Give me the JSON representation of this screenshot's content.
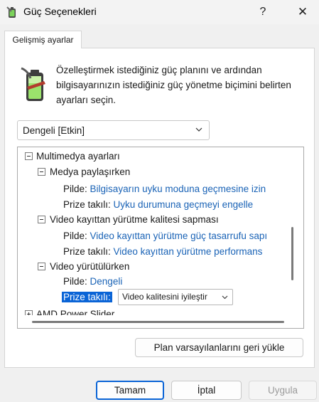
{
  "window": {
    "title": "Güç Seçenekleri",
    "help_label": "?",
    "close_label": "✕"
  },
  "tab": {
    "label": "Gelişmiş ayarlar"
  },
  "intro_text": "Özelleştirmek istediğiniz güç planını ve ardından bilgisayarınızın istediğiniz güç yönetme biçimini belirten ayarları seçin.",
  "plan_select": {
    "value": "Dengeli [Etkin]"
  },
  "tree": {
    "multimedia": "Multimedya ayarları",
    "media_sharing": "Medya paylaşırken",
    "ms_battery_label": "Pilde:",
    "ms_battery_value": "Bilgisayarın uyku moduna geçmesine izin",
    "ms_plugged_label": "Prize takılı:",
    "ms_plugged_value": "Uyku durumuna geçmeyi engelle",
    "video_quality": "Video kayıttan yürütme kalitesi sapması",
    "vq_battery_label": "Pilde:",
    "vq_battery_value": "Video kayıttan yürütme güç tasarrufu sapı",
    "vq_plugged_label": "Prize takılı:",
    "vq_plugged_value": "Video kayıttan yürütme performans",
    "video_playing": "Video yürütülürken",
    "vp_battery_label": "Pilde:",
    "vp_battery_value": "Dengeli",
    "vp_plugged_label": "Prize takılı:",
    "vp_plugged_select": "Video kalitesini iyileştir",
    "amd": "AMD Power Slider"
  },
  "buttons": {
    "restore": "Plan varsayılanlarını geri yükle",
    "ok": "Tamam",
    "cancel": "İptal",
    "apply": "Uygula"
  },
  "colors": {
    "accent": "#0a64d6",
    "link_value": "#1a63b6"
  }
}
